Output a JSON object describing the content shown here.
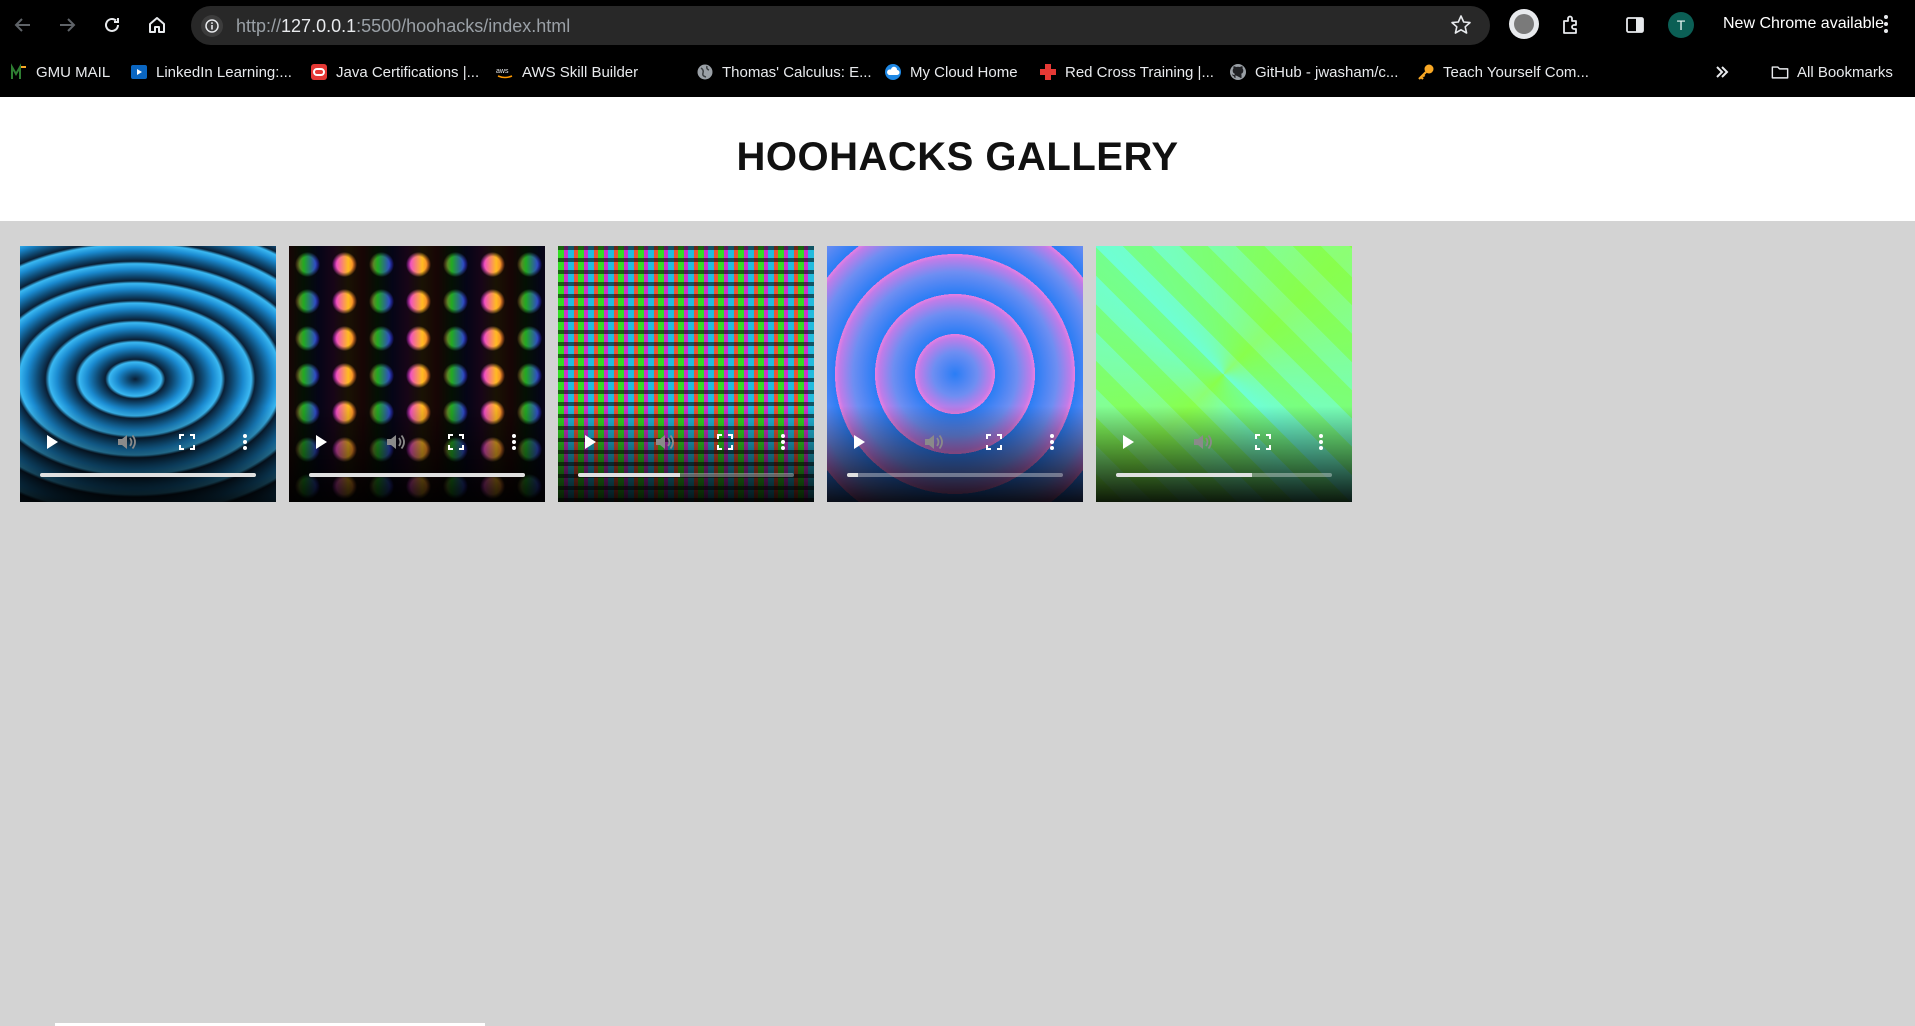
{
  "browser": {
    "url": {
      "scheme": "http://",
      "host": "127.0.0.1",
      "rest": ":5500/hoohacks/index.html"
    },
    "profile_initial": "T",
    "update_label": "New Chrome available",
    "bookmarks": [
      {
        "label": "GMU MAIL",
        "icon": "gmu-icon"
      },
      {
        "label": "LinkedIn Learning:...",
        "icon": "linkedin-learning-icon"
      },
      {
        "label": "Java Certifications |...",
        "icon": "oracle-icon"
      },
      {
        "label": "AWS Skill Builder",
        "icon": "aws-icon"
      },
      {
        "label": "Thomas' Calculus: E...",
        "icon": "globe-icon"
      },
      {
        "label": "My Cloud Home",
        "icon": "cloud-icon"
      },
      {
        "label": "Red Cross Training |...",
        "icon": "red-cross-icon"
      },
      {
        "label": "GitHub - jwasham/c...",
        "icon": "github-icon"
      },
      {
        "label": "Teach Yourself Com...",
        "icon": "key-icon"
      }
    ],
    "all_bookmarks_label": "All Bookmarks"
  },
  "page": {
    "title": "HOOHACKS GALLERY",
    "background": "#d3d3d3"
  },
  "videos": [
    {
      "progress": 1.0
    },
    {
      "progress": 1.0
    },
    {
      "progress": 0.47
    },
    {
      "progress": 0.05
    },
    {
      "progress": 0.63
    }
  ]
}
